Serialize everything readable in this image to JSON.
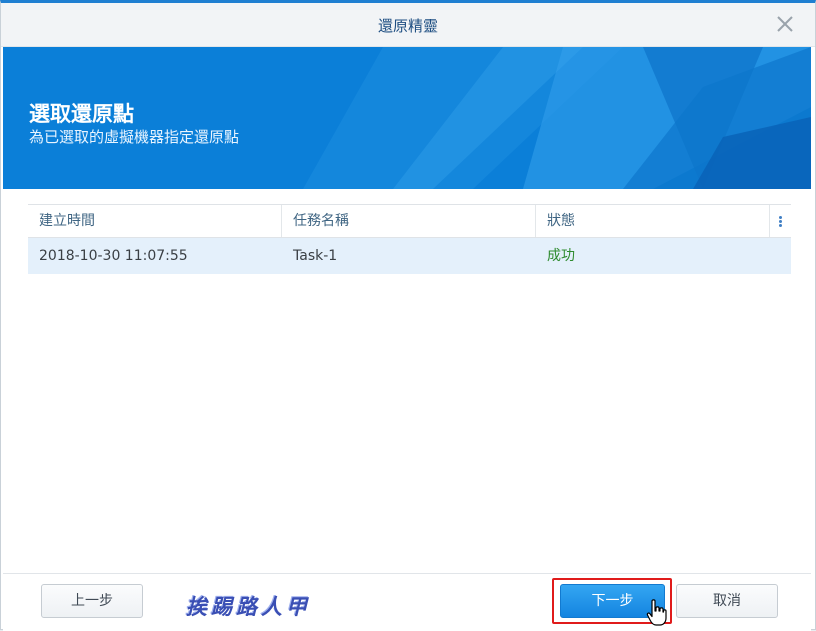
{
  "window": {
    "title": "還原精靈",
    "close_icon": "close-icon"
  },
  "banner": {
    "heading": "選取還原點",
    "subheading": "為已選取的虛擬機器指定還原點"
  },
  "table": {
    "columns": [
      "建立時間",
      "任務名稱",
      "狀態"
    ],
    "menu_icon": "vertical-dots-icon",
    "rows": [
      {
        "created": "2018-10-30 11:07:55",
        "task": "Task-1",
        "status": "成功"
      }
    ]
  },
  "footer": {
    "back_label": "上一步",
    "next_label": "下一步",
    "cancel_label": "取消",
    "watermark": "挨踢路人甲"
  },
  "colors": {
    "accent": "#1f7fd1",
    "banner": "#0b7fd8",
    "status_success": "#2e8b2e",
    "highlight": "#e01b1b"
  }
}
